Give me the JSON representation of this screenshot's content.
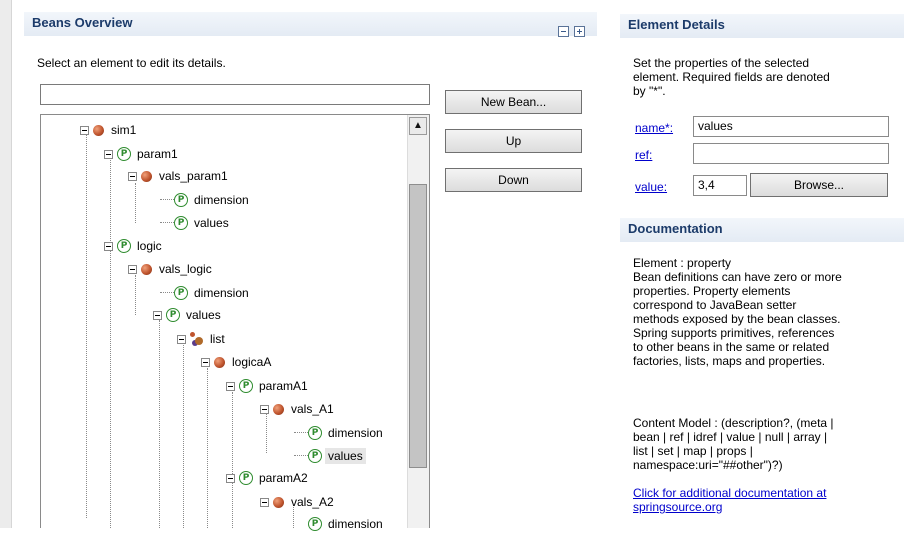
{
  "overview": {
    "title": "Beans Overview",
    "collapse_icon": "collapse-all-icon",
    "expand_icon": "expand-all-icon",
    "instruction": "Select an element to edit its details.",
    "filter": {
      "value": "",
      "placeholder": ""
    }
  },
  "buttons": {
    "new_bean": "New Bean...",
    "up": "Up",
    "down": "Down"
  },
  "tree": {
    "scroll_up_glyph": "▲",
    "nodes": [
      {
        "label": "sim1",
        "icon": "bean-icon",
        "expanded": true
      },
      {
        "label": "param1",
        "icon": "property-icon",
        "expanded": true
      },
      {
        "label": "vals_param1",
        "icon": "bean-icon",
        "expanded": true
      },
      {
        "label": "dimension",
        "icon": "property-icon",
        "expanded": false
      },
      {
        "label": "values",
        "icon": "property-icon",
        "expanded": false
      },
      {
        "label": "logic",
        "icon": "property-icon",
        "expanded": true
      },
      {
        "label": "vals_logic",
        "icon": "bean-icon",
        "expanded": true
      },
      {
        "label": "dimension",
        "icon": "property-icon",
        "expanded": false
      },
      {
        "label": "values",
        "icon": "property-icon",
        "expanded": true
      },
      {
        "label": "list",
        "icon": "list-icon",
        "expanded": true
      },
      {
        "label": "logicaA",
        "icon": "bean-icon",
        "expanded": true
      },
      {
        "label": "paramA1",
        "icon": "property-icon",
        "expanded": true
      },
      {
        "label": "vals_A1",
        "icon": "bean-icon",
        "expanded": true
      },
      {
        "label": "dimension",
        "icon": "property-icon",
        "expanded": false
      },
      {
        "label": "values",
        "icon": "property-icon",
        "expanded": false,
        "selected": true
      },
      {
        "label": "paramA2",
        "icon": "property-icon",
        "expanded": true
      },
      {
        "label": "vals_A2",
        "icon": "bean-icon",
        "expanded": true
      },
      {
        "label": "dimension",
        "icon": "property-icon",
        "expanded": false
      }
    ]
  },
  "details": {
    "title": "Element Details",
    "description": "Set the properties of the selected\nelement. Required fields are denoted\nby \"*\".",
    "name_label": "name*:",
    "name_value": "values",
    "ref_label": "ref:",
    "ref_value": "",
    "value_label": "value:",
    "value_value": "3,4",
    "browse_label": "Browse..."
  },
  "documentation": {
    "title": "Documentation",
    "body": "Element : property\nBean definitions can have zero or more\nproperties. Property elements\ncorrespond to JavaBean setter\nmethods exposed by the bean classes.\nSpring supports primitives, references\nto other beans in the same or related\nfactories, lists, maps and properties.",
    "content_model": "Content Model : (description?, (meta |\nbean | ref | idref | value | null | array |\nlist | set | map | props |\nnamespace:uri=\"##other\")?)",
    "link_line1": "Click for additional documentation at",
    "link_line2": "springsource.org"
  },
  "colors": {
    "header_text": "#1c3b6a",
    "link": "#0000cc",
    "property_icon": "#2f8c2f",
    "bean_icon": "#c0552e"
  }
}
